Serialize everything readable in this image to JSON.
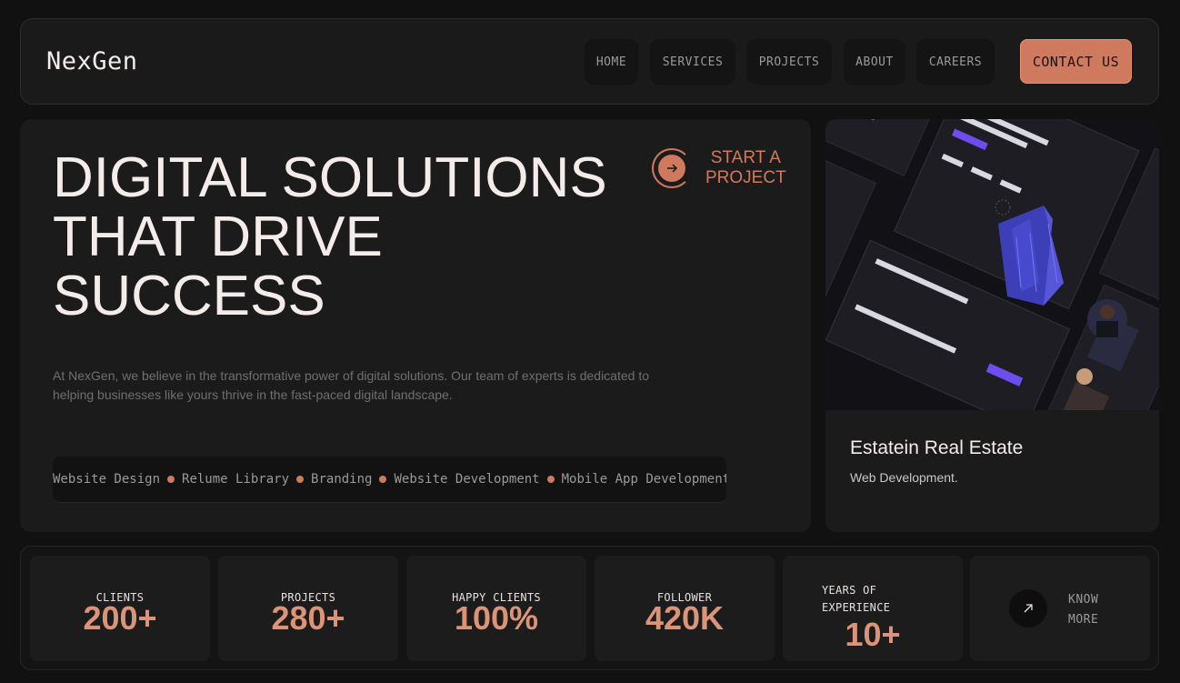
{
  "brand": {
    "logo": "NexGen",
    "accent": "#cf7a5e"
  },
  "nav": {
    "items": [
      "HOME",
      "SERVICES",
      "PROJECTS",
      "ABOUT",
      "CAREERS"
    ],
    "contact_label": "CONTACT US"
  },
  "hero": {
    "title_line1": "DIGITAL SOLUTIONS",
    "title_line2": "THAT DRIVE",
    "title_line3": "SUCCESS",
    "cta_line1": "START A",
    "cta_line2": "PROJECT",
    "description_line1": "At NexGen, we believe in the transformative power of digital solutions. Our team of experts is dedicated to",
    "description_line2": "helping businesses like yours thrive in the fast-paced digital landscape.",
    "services": [
      "Website Design",
      "Relume Library",
      "Branding",
      "Website Development",
      "Mobile App Development"
    ]
  },
  "project": {
    "title": "Estatein Real Estate",
    "subtitle": "Web Development.",
    "image_alt": "estatein-website-mockup"
  },
  "stats": [
    {
      "label": "CLIENTS",
      "value": "200+"
    },
    {
      "label": "PROJECTS",
      "value": "280+"
    },
    {
      "label": "HAPPY CLIENTS",
      "value": "100%"
    },
    {
      "label": "FOLLOWER",
      "value": "420K"
    }
  ],
  "experience": {
    "label_line1": "YEARS OF",
    "label_line2": "EXPERIENCE",
    "value": "10+"
  },
  "know_more": {
    "line1": "KNOW",
    "line2": "MORE",
    "icon": "arrow-up-right-icon"
  }
}
